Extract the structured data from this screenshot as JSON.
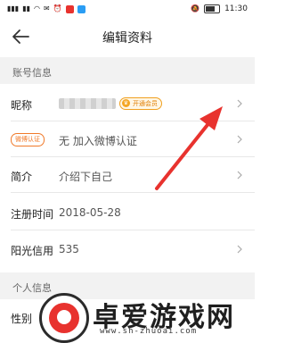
{
  "status_bar": {
    "time": "11:30",
    "battery_level": 0.7
  },
  "header": {
    "title": "编辑资料"
  },
  "sections": {
    "account": {
      "title": "账号信息"
    },
    "personal": {
      "title": "个人信息"
    }
  },
  "rows": {
    "nickname": {
      "label": "昵称",
      "vip_badge": "开通会员"
    },
    "weibo": {
      "tag": "微博认证",
      "value": "无 加入微博认证"
    },
    "intro": {
      "label": "简介",
      "value": "介绍下自己"
    },
    "register_time": {
      "label": "注册时间",
      "value": "2018-05-28"
    },
    "sunshine_credit": {
      "label": "阳光信用",
      "value": "535"
    },
    "gender": {
      "label": "性别"
    }
  },
  "watermark": {
    "title": "卓爱游戏网",
    "url": "www.sh-zhuoai.com"
  },
  "colors": {
    "accent": "#f07a2a",
    "arrow": "#e8322e",
    "section_bg": "#f2f2f2"
  }
}
